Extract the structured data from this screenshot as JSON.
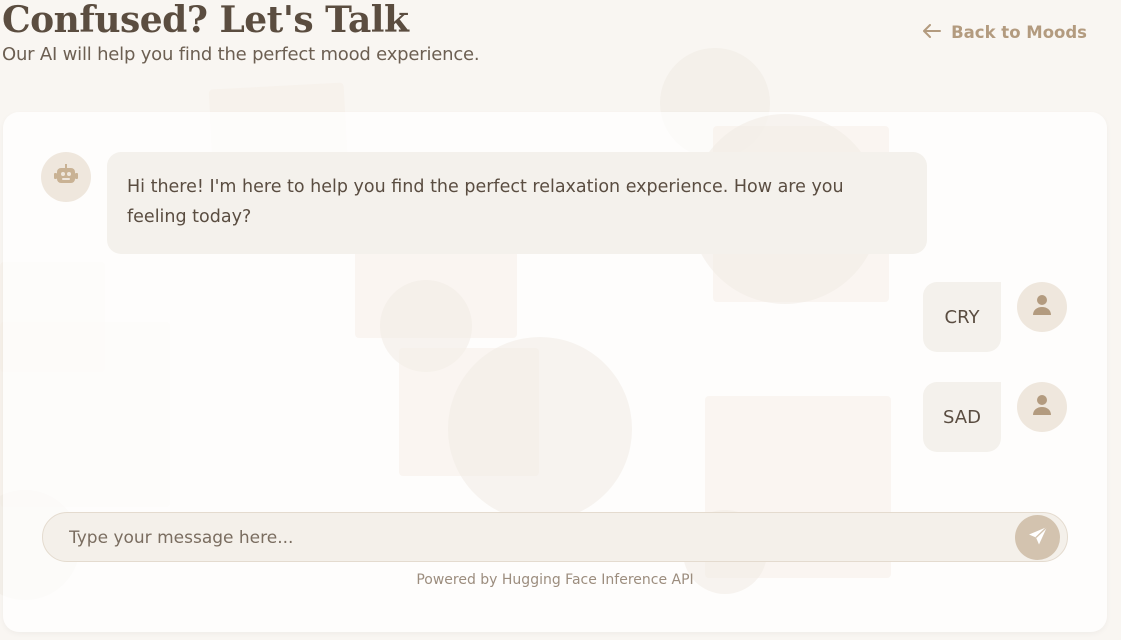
{
  "header": {
    "title": "Confused? Let's Talk",
    "subtitle": "Our AI will help you find the perfect mood experience."
  },
  "nav": {
    "back_label": "Back to Moods",
    "back_icon": "arrow-left-icon"
  },
  "chat": {
    "messages": [
      {
        "sender": "bot",
        "text": "Hi there! I'm here to help you find the perfect relaxation experience. How are you feeling today?",
        "avatar_icon": "robot-icon"
      },
      {
        "sender": "user",
        "text": "CRY",
        "avatar_icon": "user-icon"
      },
      {
        "sender": "user",
        "text": "SAD",
        "avatar_icon": "user-icon"
      }
    ]
  },
  "composer": {
    "placeholder": "Type your message here...",
    "value": "",
    "send_icon": "send-icon"
  },
  "footer": {
    "powered_by": "Powered by Hugging Face Inference API"
  },
  "colors": {
    "page_bg": "#f9f6f2",
    "accent": "#b39b7f",
    "bubble_bg": "#f4f1ec",
    "send_button": "#d3c3af",
    "text": "#5a4d41"
  }
}
